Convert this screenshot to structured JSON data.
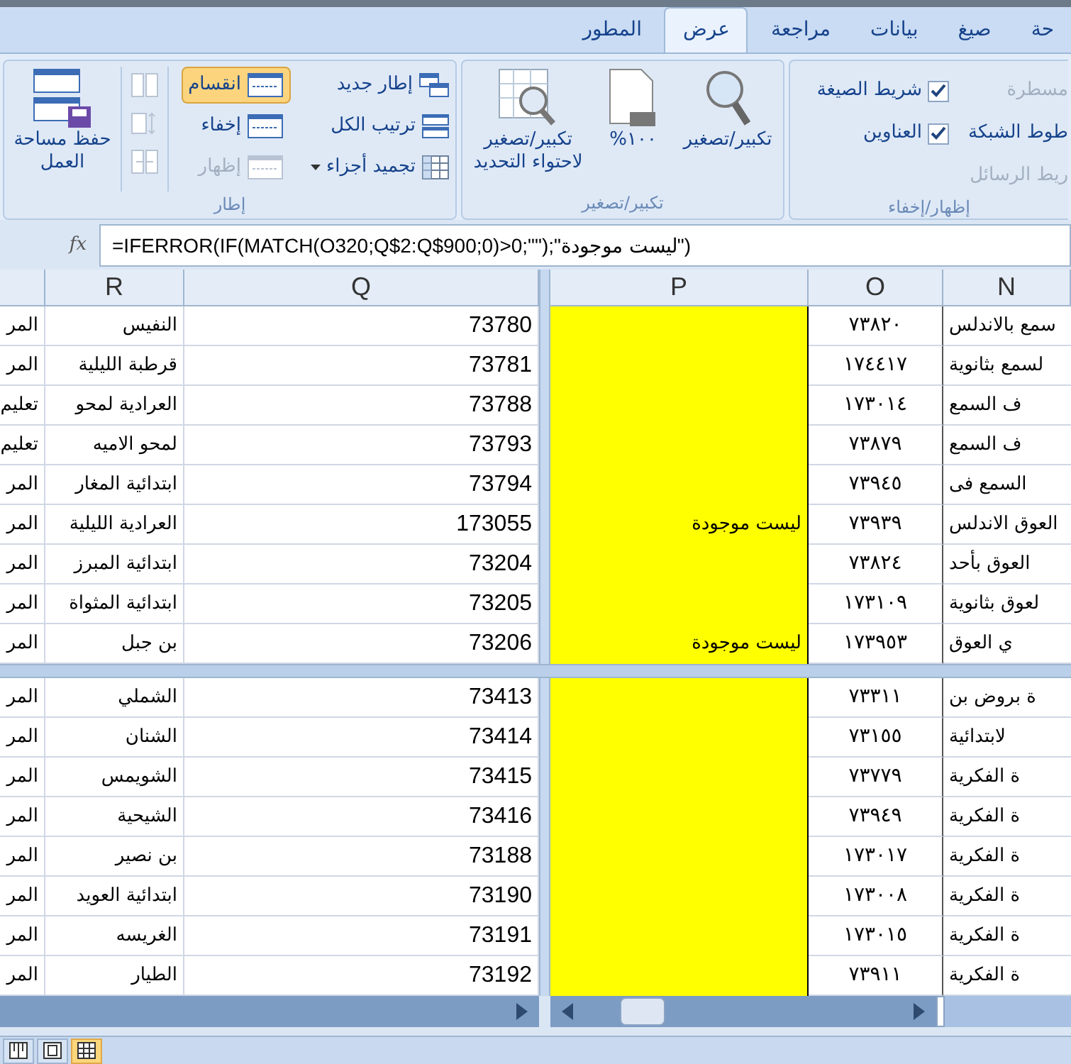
{
  "tabs": [
    {
      "label": "حة",
      "selected": false
    },
    {
      "label": "صيغ",
      "selected": false
    },
    {
      "label": "بيانات",
      "selected": false
    },
    {
      "label": "مراجعة",
      "selected": false
    },
    {
      "label": "عرض",
      "selected": true
    },
    {
      "label": "المطور",
      "selected": false
    }
  ],
  "window_group": {
    "label": "إطار",
    "save_workspace": [
      "حفظ مساحة",
      "العمل"
    ],
    "split_items": [
      {
        "label": "انقسام",
        "selected": true,
        "disabled": false
      },
      {
        "label": "إخفاء",
        "selected": false,
        "disabled": false
      },
      {
        "label": "إظهار",
        "selected": false,
        "disabled": true
      }
    ],
    "arrange_items": [
      {
        "label": "إطار جديد",
        "dropdown": false
      },
      {
        "label": "ترتيب الكل",
        "dropdown": false
      },
      {
        "label": "تجميد أجزاء",
        "dropdown": true
      }
    ]
  },
  "zoom_group": {
    "label": "تكبير/تصغير",
    "buttons": [
      {
        "kind": "zoom",
        "lines": [
          "تكبير/تصغير"
        ]
      },
      {
        "kind": "hundred",
        "lines": [
          "١٠٠%"
        ]
      },
      {
        "kind": "fit",
        "lines": [
          "تكبير/تصغير",
          "لاحتواء التحديد"
        ]
      }
    ]
  },
  "show_group": {
    "label": "إظهار/إخفاء",
    "checkboxes": [
      {
        "label": "شريط الصيغة",
        "checked": true
      },
      {
        "label": "العناوين",
        "checked": true
      }
    ],
    "cut_items": [
      {
        "label": "مسطرة",
        "disabled": true
      },
      {
        "label": "طوط الشبكة",
        "disabled": false
      },
      {
        "label": "ريط الرسائل",
        "disabled": true
      }
    ]
  },
  "formula_bar": {
    "function_label": "fx",
    "formula": "=IFERROR(IF(MATCH(O320;Q$2:Q$900;0)>0;\"\");\"ليست موجودة\")"
  },
  "columns": [
    "N",
    "O",
    "P",
    "Q",
    "R"
  ],
  "top_rows": [
    {
      "column_1": "المر",
      "r": "النفيس",
      "q": "73780",
      "o": "٧٣٨٢٠",
      "n": "سمع بالاندلس"
    },
    {
      "column_1": "المر",
      "r": "قرطبة الليلية",
      "q": "73781",
      "o": "١٧٤٤١٧",
      "n": "لسمع بثانوية"
    },
    {
      "column_1": "تعليم",
      "r": "العرادية لمحو",
      "q": "73788",
      "o": "١٧٣٠١٤",
      "n": "ف السمع"
    },
    {
      "column_1": "تعليم",
      "r": "لمحو الاميه",
      "q": "73793",
      "o": "٧٣٨٧٩",
      "n": "ف السمع"
    },
    {
      "column_1": "المر",
      "r": "ابتدائية المغار",
      "q": "73794",
      "o": "٧٣٩٤٥",
      "n": "السمع فى"
    },
    {
      "column_1": "المر",
      "r": "العرادية الليلية",
      "q": "173055",
      "p": "ليست موجودة",
      "o": "٧٣٩٣٩",
      "n": "العوق الاندلس"
    },
    {
      "column_1": "المر",
      "r": "ابتدائية المبرز",
      "q": "73204",
      "o": "٧٣٨٢٤",
      "n": "العوق بأحد"
    },
    {
      "column_1": "المر",
      "r": "ابتدائية المثواة",
      "q": "73205",
      "o": "١٧٣١٠٩",
      "n": "لعوق بثانوية"
    },
    {
      "column_1": "المر",
      "r": "بن جبل",
      "q": "73206",
      "p": "ليست موجودة",
      "o": "١٧٣٩٥٣",
      "n": "ي العوق"
    }
  ],
  "bottom_rows": [
    {
      "column_1": "المر",
      "r": "الشملي",
      "q": "73413",
      "o": "٧٣٣١١",
      "n": "ة بروض بن"
    },
    {
      "column_1": "المر",
      "r": "الشنان",
      "q": "73414",
      "o": "٧٣١٥٥",
      "n": "لابتدائية"
    },
    {
      "column_1": "المر",
      "r": "الشويمس",
      "q": "73415",
      "o": "٧٣٧٧٩",
      "n": "ة الفكرية"
    },
    {
      "column_1": "المر",
      "r": "الشيحية",
      "q": "73416",
      "o": "٧٣٩٤٩",
      "n": "ة الفكرية"
    },
    {
      "column_1": "المر",
      "r": "بن نصير",
      "q": "73188",
      "o": "١٧٣٠١٧",
      "n": "ة الفكرية"
    },
    {
      "column_1": "المر",
      "r": "ابتدائية العويد",
      "q": "73190",
      "o": "١٧٣٠٠٨",
      "n": "ة الفكرية"
    },
    {
      "column_1": "المر",
      "r": "الغريسه",
      "q": "73191",
      "o": "١٧٣٠١٥",
      "n": "ة الفكرية"
    },
    {
      "column_1": "المر",
      "r": "الطيار",
      "q": "73192",
      "o": "٧٣٩١١",
      "n": "ة الفكرية"
    }
  ],
  "status_bar": {
    "view_buttons": [
      {
        "kind": "page-break",
        "selected": false
      },
      {
        "kind": "page-layout",
        "selected": false
      },
      {
        "kind": "normal",
        "selected": true
      }
    ]
  }
}
